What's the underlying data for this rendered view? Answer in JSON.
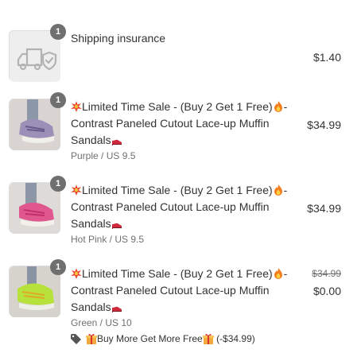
{
  "items": [
    {
      "title": "Shipping insurance",
      "quantity": "1",
      "price": "$1.40",
      "image": "shipping-truck-shield-icon"
    },
    {
      "title_parts": [
        "Limited Time Sale - (Buy 2 Get 1 Free)",
        "-Contrast Paneled Cutout Lace-up Muffin Sandals"
      ],
      "quantity": "1",
      "price": "$34.99",
      "variant": "Purple / US 9.5"
    },
    {
      "title_parts": [
        "Limited Time Sale - (Buy 2 Get 1 Free)",
        "-Contrast Paneled Cutout Lace-up Muffin Sandals"
      ],
      "quantity": "1",
      "price": "$34.99",
      "variant": "Hot Pink / US 9.5"
    },
    {
      "title_parts": [
        "Limited Time Sale - (Buy 2 Get 1 Free)",
        "-Contrast Paneled Cutout Lace-up Muffin Sandals"
      ],
      "quantity": "1",
      "original_price": "$34.99",
      "price": "$0.00",
      "variant": "Green / US 10",
      "discount": {
        "label": "Buy More Get More Free",
        "amount": "(-$34.99)"
      }
    }
  ],
  "icons": {
    "explosion": "collision-emoji",
    "fire": "fire-emoji",
    "shoe": "high-heel-emoji",
    "gift": "gift-emoji",
    "tag": "tag-icon"
  }
}
